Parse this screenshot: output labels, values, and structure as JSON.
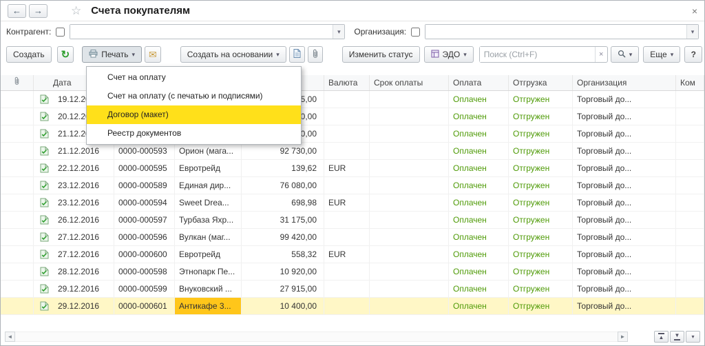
{
  "titlebar": {
    "back": "←",
    "forward": "→",
    "favorite": "☆",
    "title": "Счета покупателям",
    "close": "×"
  },
  "filters": {
    "counterparty_label": "Контрагент:",
    "organization_label": "Организация:",
    "dropdown_arrow": "▾"
  },
  "toolbar": {
    "create": "Создать",
    "refresh_icon": "↻",
    "print": "Печать",
    "envelope_icon": "✉",
    "create_based_on": "Создать на основании",
    "change_status": "Изменить статус",
    "edo": "ЭДО",
    "search_placeholder": "Поиск (Ctrl+F)",
    "search_clear": "×",
    "more": "Еще",
    "help": "?",
    "arrow": "▾"
  },
  "print_menu": {
    "items": [
      {
        "label": "Счет на оплату",
        "highlighted": false
      },
      {
        "label": "Счет на оплату (с печатью и подписями)",
        "highlighted": false
      },
      {
        "label": "Договор (макет)",
        "highlighted": true
      },
      {
        "label": "Реестр документов",
        "highlighted": false
      }
    ]
  },
  "table": {
    "headers": {
      "date": "Дата",
      "number": "",
      "counterparty": "",
      "amount": "",
      "currency": "Валюта",
      "due": "Срок оплаты",
      "payment": "Оплата",
      "shipment": "Отгрузка",
      "org": "Организация",
      "comment": "Ком"
    },
    "rows": [
      {
        "date": "19.12.2016",
        "number": "",
        "counterparty": "",
        "amount": "15,00",
        "currency": "",
        "due": "",
        "payment": "Оплачен",
        "shipment": "Отгружен",
        "org": "Торговый до...",
        "comment": "",
        "selected": false
      },
      {
        "date": "20.12.2016",
        "number": "",
        "counterparty": "",
        "amount": "80,00",
        "currency": "",
        "due": "",
        "payment": "Оплачен",
        "shipment": "Отгружен",
        "org": "Торговый до...",
        "comment": "",
        "selected": false
      },
      {
        "date": "21.12.2016",
        "number": "",
        "counterparty": "",
        "amount": "20,00",
        "currency": "",
        "due": "",
        "payment": "Оплачен",
        "shipment": "Отгружен",
        "org": "Торговый до...",
        "comment": "",
        "selected": false
      },
      {
        "date": "21.12.2016",
        "number": "0000-000593",
        "counterparty": "Орион (мага...",
        "amount": "92 730,00",
        "currency": "",
        "due": "",
        "payment": "Оплачен",
        "shipment": "Отгружен",
        "org": "Торговый до...",
        "comment": "",
        "selected": false
      },
      {
        "date": "22.12.2016",
        "number": "0000-000595",
        "counterparty": "Евротрейд",
        "amount": "139,62",
        "currency": "EUR",
        "due": "",
        "payment": "Оплачен",
        "shipment": "Отгружен",
        "org": "Торговый до...",
        "comment": "",
        "selected": false
      },
      {
        "date": "23.12.2016",
        "number": "0000-000589",
        "counterparty": "Единая дир...",
        "amount": "76 080,00",
        "currency": "",
        "due": "",
        "payment": "Оплачен",
        "shipment": "Отгружен",
        "org": "Торговый до...",
        "comment": "",
        "selected": false
      },
      {
        "date": "23.12.2016",
        "number": "0000-000594",
        "counterparty": "Sweet Drea...",
        "amount": "698,98",
        "currency": "EUR",
        "due": "",
        "payment": "Оплачен",
        "shipment": "Отгружен",
        "org": "Торговый до...",
        "comment": "",
        "selected": false
      },
      {
        "date": "26.12.2016",
        "number": "0000-000597",
        "counterparty": "Турбаза Яхр...",
        "amount": "31 175,00",
        "currency": "",
        "due": "",
        "payment": "Оплачен",
        "shipment": "Отгружен",
        "org": "Торговый до...",
        "comment": "",
        "selected": false
      },
      {
        "date": "27.12.2016",
        "number": "0000-000596",
        "counterparty": "Вулкан (маг...",
        "amount": "99 420,00",
        "currency": "",
        "due": "",
        "payment": "Оплачен",
        "shipment": "Отгружен",
        "org": "Торговый до...",
        "comment": "",
        "selected": false
      },
      {
        "date": "27.12.2016",
        "number": "0000-000600",
        "counterparty": "Евротрейд",
        "amount": "558,32",
        "currency": "EUR",
        "due": "",
        "payment": "Оплачен",
        "shipment": "Отгружен",
        "org": "Торговый до...",
        "comment": "",
        "selected": false
      },
      {
        "date": "28.12.2016",
        "number": "0000-000598",
        "counterparty": "Этнопарк Пе...",
        "amount": "10 920,00",
        "currency": "",
        "due": "",
        "payment": "Оплачен",
        "shipment": "Отгружен",
        "org": "Торговый до...",
        "comment": "",
        "selected": false
      },
      {
        "date": "29.12.2016",
        "number": "0000-000599",
        "counterparty": "Внуковский ...",
        "amount": "27 915,00",
        "currency": "",
        "due": "",
        "payment": "Оплачен",
        "shipment": "Отгружен",
        "org": "Торговый до...",
        "comment": "",
        "selected": false
      },
      {
        "date": "29.12.2016",
        "number": "0000-000601",
        "counterparty": "Антикафе 3...",
        "amount": "10 400,00",
        "currency": "",
        "due": "",
        "payment": "Оплачен",
        "shipment": "Отгружен",
        "org": "Торговый до...",
        "comment": "",
        "selected": true,
        "focus_cell": "counterparty"
      }
    ]
  },
  "footer": {
    "scroll_left": "◄",
    "scroll_right": "►",
    "to_top": "▲",
    "to_bottom": "▼",
    "more": "▾"
  },
  "colors": {
    "status_green": "#4e9a06",
    "selection_yellow": "#fff7c6",
    "menu_highlight": "#ffe01a",
    "focus_cell": "#ffc61a"
  }
}
